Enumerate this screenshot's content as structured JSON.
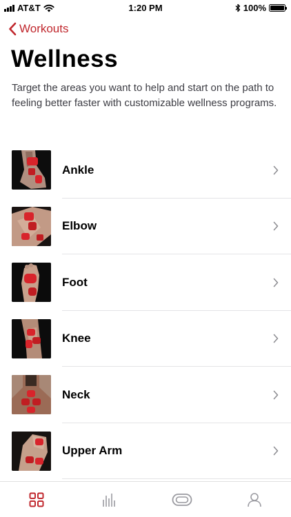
{
  "status_bar": {
    "carrier": "AT&T",
    "time": "1:20 PM",
    "battery": "100%",
    "battery_level": 1.0,
    "icons": [
      "signal-icon",
      "wifi-icon",
      "bluetooth-icon",
      "battery-icon"
    ]
  },
  "nav": {
    "back_label": "Workouts",
    "back_icon": "chevron-left-icon"
  },
  "page": {
    "title": "Wellness",
    "description": "Target the areas you want to help and start on the path to feeling better faster with customizable wellness programs."
  },
  "programs": [
    {
      "label": "Ankle"
    },
    {
      "label": "Elbow"
    },
    {
      "label": "Foot"
    },
    {
      "label": "Knee"
    },
    {
      "label": "Neck"
    },
    {
      "label": "Upper Arm"
    }
  ],
  "tab_bar": {
    "tabs": [
      {
        "icon": "grid-icon",
        "active": true
      },
      {
        "icon": "bar-chart-icon",
        "active": false
      },
      {
        "icon": "device-icon",
        "active": false
      },
      {
        "icon": "profile-icon",
        "active": false
      }
    ]
  },
  "colors": {
    "accent": "#c0272d",
    "inactive_icon": "#9a9aa0",
    "divider": "#e3e3e6"
  }
}
